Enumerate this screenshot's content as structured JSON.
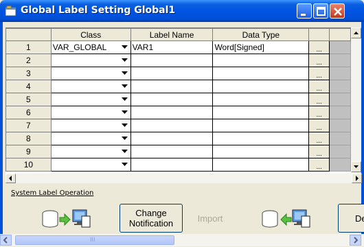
{
  "window": {
    "title": "Global Label Setting Global1"
  },
  "grid": {
    "columns": [
      "Class",
      "Label Name",
      "Data Type"
    ],
    "rows": [
      {
        "num": "1",
        "class": "VAR_GLOBAL",
        "label": "VAR1",
        "type": "Word[Signed]"
      },
      {
        "num": "2",
        "class": "",
        "label": "",
        "type": ""
      },
      {
        "num": "3",
        "class": "",
        "label": "",
        "type": ""
      },
      {
        "num": "4",
        "class": "",
        "label": "",
        "type": ""
      },
      {
        "num": "5",
        "class": "",
        "label": "",
        "type": ""
      },
      {
        "num": "6",
        "class": "",
        "label": "",
        "type": ""
      },
      {
        "num": "7",
        "class": "",
        "label": "",
        "type": ""
      },
      {
        "num": "8",
        "class": "",
        "label": "",
        "type": ""
      },
      {
        "num": "9",
        "class": "",
        "label": "",
        "type": ""
      },
      {
        "num": "10",
        "class": "",
        "label": "",
        "type": ""
      }
    ],
    "ellipsis": "..."
  },
  "system_label": {
    "section_title": "System Label Operation",
    "change_notification": "Change\nNotification",
    "import": "Import",
    "partial_button": "De"
  },
  "bottom_scroll": {
    "thumb_text": "III"
  }
}
